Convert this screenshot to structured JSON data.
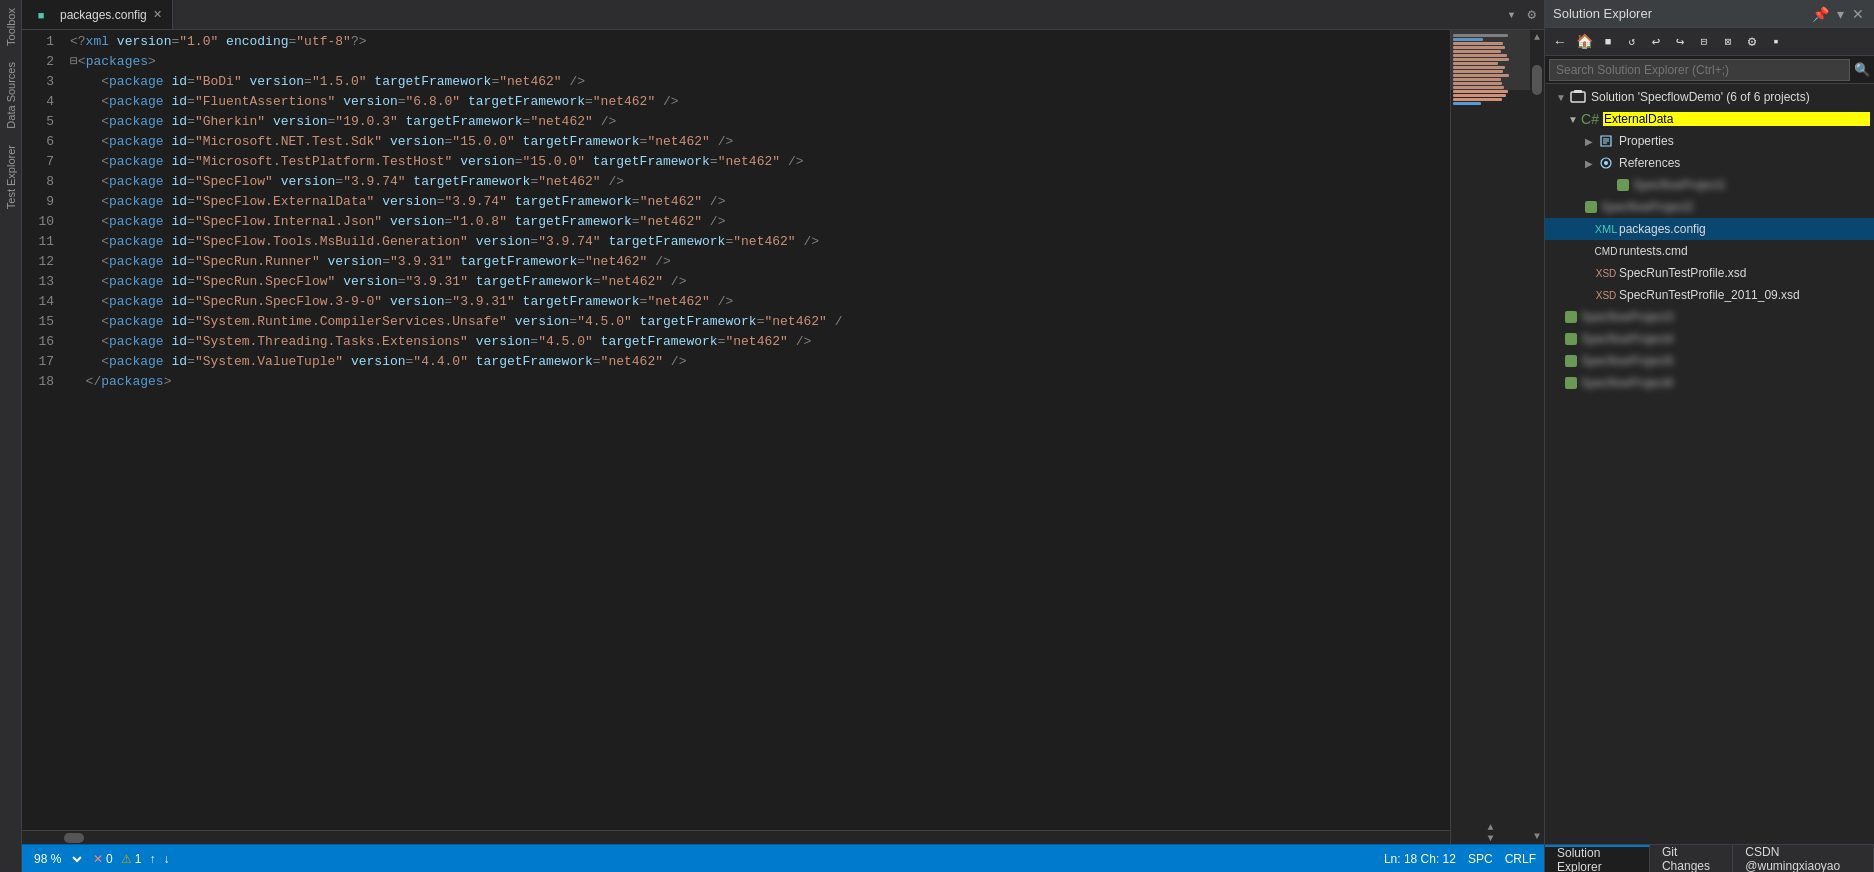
{
  "leftSidebar": {
    "tabs": [
      "Toolbox",
      "Data Sources",
      "Test Explorer"
    ]
  },
  "tabBar": {
    "activeTab": {
      "name": "packages.config",
      "modified": false
    },
    "actions": [
      "▾",
      "⊕"
    ]
  },
  "editor": {
    "lines": [
      {
        "num": 1,
        "content": "<?xml version=\"1.0\" encoding=\"utf-8\"?>"
      },
      {
        "num": 2,
        "content": "  <packages>"
      },
      {
        "num": 3,
        "content": "    <package id=\"BoDi\" version=\"1.5.0\" targetFramework=\"net462\" />"
      },
      {
        "num": 4,
        "content": "    <package id=\"FluentAssertions\" version=\"6.8.0\" targetFramework=\"net462\" />"
      },
      {
        "num": 5,
        "content": "    <package id=\"Gherkin\" version=\"19.0.3\" targetFramework=\"net462\" />"
      },
      {
        "num": 6,
        "content": "    <package id=\"Microsoft.NET.Test.Sdk\" version=\"15.0.0\" targetFramework=\"net462\" />"
      },
      {
        "num": 7,
        "content": "    <package id=\"Microsoft.TestPlatform.TestHost\" version=\"15.0.0\" targetFramework=\"net462\" />"
      },
      {
        "num": 8,
        "content": "    <package id=\"SpecFlow\" version=\"3.9.74\" targetFramework=\"net462\" />"
      },
      {
        "num": 9,
        "content": "    <package id=\"SpecFlow.ExternalData\" version=\"3.9.74\" targetFramework=\"net462\" />"
      },
      {
        "num": 10,
        "content": "    <package id=\"SpecFlow.Internal.Json\" version=\"1.0.8\" targetFramework=\"net462\" />"
      },
      {
        "num": 11,
        "content": "    <package id=\"SpecFlow.Tools.MsBuild.Generation\" version=\"3.9.74\" targetFramework=\"net462\" />"
      },
      {
        "num": 12,
        "content": "    <package id=\"SpecRun.Runner\" version=\"3.9.31\" targetFramework=\"net462\" />"
      },
      {
        "num": 13,
        "content": "    <package id=\"SpecRun.SpecFlow\" version=\"3.9.31\" targetFramework=\"net462\" />"
      },
      {
        "num": 14,
        "content": "    <package id=\"SpecRun.SpecFlow.3-9-0\" version=\"3.9.31\" targetFramework=\"net462\" />"
      },
      {
        "num": 15,
        "content": "    <package id=\"System.Runtime.CompilerServices.Unsafe\" version=\"4.5.0\" targetFramework=\"net462\" /"
      },
      {
        "num": 16,
        "content": "    <package id=\"System.Threading.Tasks.Extensions\" version=\"4.5.0\" targetFramework=\"net462\" />"
      },
      {
        "num": 17,
        "content": "    <package id=\"System.ValueTuple\" version=\"4.4.0\" targetFramework=\"net462\" />"
      },
      {
        "num": 18,
        "content": "  </packages>"
      }
    ]
  },
  "statusBar": {
    "zoom": "98 %",
    "errorCount": "0",
    "warningCount": "1",
    "position": "Ln: 18",
    "column": "Ch: 12",
    "encoding": "SPC",
    "lineEnding": "CRLF"
  },
  "solutionExplorer": {
    "title": "Solution Explorer",
    "searchPlaceholder": "Search Solution Explorer (Ctrl+;)",
    "solutionLabel": "Solution 'SpecflowDemo' (6 of 6 projects)",
    "tree": [
      {
        "id": "solution",
        "label": "Solution 'SpecflowDemo' (6 of 6 projects)",
        "indent": 0,
        "type": "solution",
        "expanded": true,
        "arrow": ""
      },
      {
        "id": "externaldata",
        "label": "ExternalData",
        "indent": 1,
        "type": "cs-project",
        "expanded": true,
        "arrow": "▼",
        "highlight": true
      },
      {
        "id": "properties",
        "label": "Properties",
        "indent": 2,
        "type": "folder",
        "expanded": false,
        "arrow": "▶"
      },
      {
        "id": "references",
        "label": "References",
        "indent": 2,
        "type": "references",
        "expanded": false,
        "arrow": "▶"
      },
      {
        "id": "blurred1",
        "label": "blurred item 1",
        "indent": 2,
        "type": "blurred",
        "expanded": false,
        "arrow": ""
      },
      {
        "id": "blurred2",
        "label": "blurred item 2",
        "indent": 2,
        "type": "blurred",
        "expanded": false,
        "arrow": ""
      },
      {
        "id": "packages-config",
        "label": "packages.config",
        "indent": 2,
        "type": "xml",
        "selected": true,
        "arrow": ""
      },
      {
        "id": "runtests",
        "label": "runtests.cmd",
        "indent": 2,
        "type": "cmd",
        "arrow": ""
      },
      {
        "id": "specrun-profile",
        "label": "SpecRunTestProfile.xsd",
        "indent": 2,
        "type": "xsd",
        "arrow": ""
      },
      {
        "id": "specrun-profile-2011",
        "label": "SpecRunTestProfile_2011_09.xsd",
        "indent": 2,
        "type": "xsd",
        "arrow": ""
      },
      {
        "id": "blurred3",
        "label": "blurred project 3",
        "indent": 1,
        "type": "blurred",
        "expanded": false,
        "arrow": ""
      },
      {
        "id": "blurred4",
        "label": "blurred project 4",
        "indent": 1,
        "type": "blurred",
        "expanded": false,
        "arrow": ""
      },
      {
        "id": "blurred5",
        "label": "blurred project 5",
        "indent": 1,
        "type": "blurred",
        "expanded": false,
        "arrow": ""
      },
      {
        "id": "blurred6",
        "label": "blurred project 6",
        "indent": 1,
        "type": "blurred",
        "expanded": false,
        "arrow": ""
      }
    ],
    "bottomTabs": [
      "Solution Explorer",
      "Git Changes",
      "CSDN @wumingxiaoyao"
    ]
  }
}
